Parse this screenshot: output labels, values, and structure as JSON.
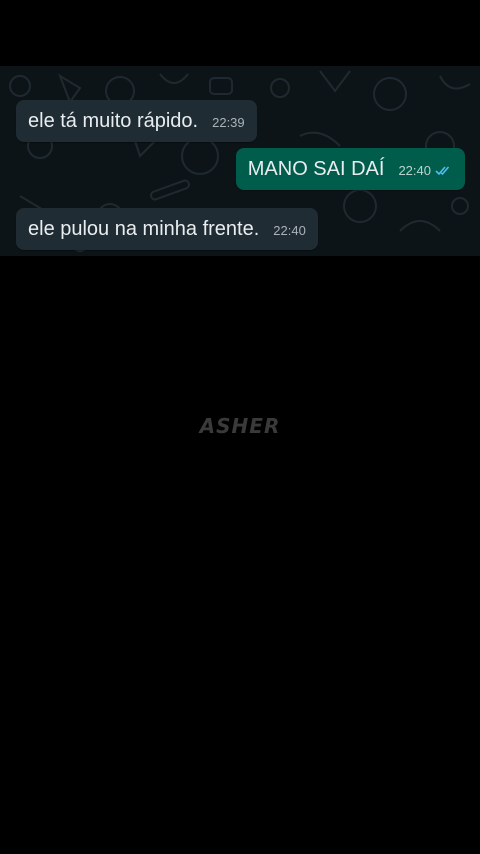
{
  "messages": [
    {
      "direction": "incoming",
      "text": "ele tá muito rápido.",
      "time": "22:39"
    },
    {
      "direction": "outgoing",
      "text": "MANO SAI DAÍ",
      "time": "22:40",
      "status": "read-double-check-icon"
    },
    {
      "direction": "incoming",
      "text": "ele pulou na minha frente.",
      "time": "22:40"
    }
  ],
  "watermark": "ASHER",
  "colors": {
    "background": "#000000",
    "chat_bg": "#0d1418",
    "incoming_bubble": "#1f2c33",
    "outgoing_bubble": "#005c4b",
    "read_ticks": "#53bdeb"
  }
}
